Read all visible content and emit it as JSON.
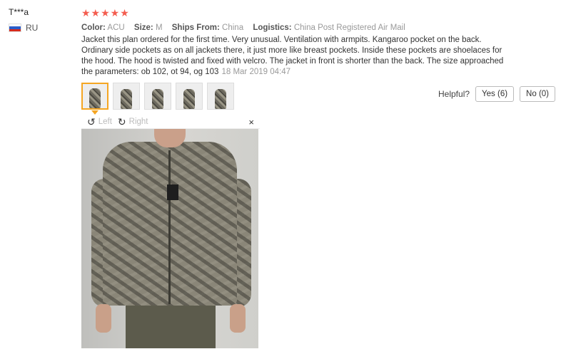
{
  "user": {
    "name": "T***a",
    "country": "RU"
  },
  "review": {
    "stars": "★★★★★",
    "meta": [
      {
        "key": "Color:",
        "value": "ACU"
      },
      {
        "key": "Size:",
        "value": "M"
      },
      {
        "key": "Ships From:",
        "value": "China"
      },
      {
        "key": "Logistics:",
        "value": "China Post Registered Air Mail"
      }
    ],
    "text": "Jacket this plan ordered for the first time. Very unusual. Ventilation with armpits. Kangaroo pocket on the back. Ordinary side pockets as on all jackets there, it just more like breast pockets. Inside these pockets are shoelaces for the hood. The hood is twisted and fixed with velcro. The jacket in front is shorter than the back. The size approached the parameters: ob 102, ot 94, og 103",
    "date": "18 Mar 2019 04:47"
  },
  "helpful": {
    "label": "Helpful?",
    "yes": "Yes (6)",
    "no": "No (0)"
  },
  "viewer": {
    "left_label": "Left",
    "right_label": "Right",
    "close": "×"
  },
  "icons": {
    "rotate_left": "rotate-left-icon",
    "rotate_right": "rotate-right-icon",
    "close": "close-icon"
  },
  "colors": {
    "stars": "#f45d4f",
    "active_thumb": "#f5a623"
  }
}
